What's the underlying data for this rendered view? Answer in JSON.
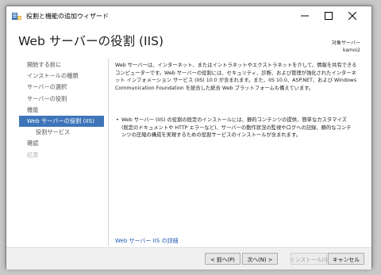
{
  "window": {
    "title": "役割と機能の追加ウィザード"
  },
  "header": {
    "page_title": "Web サーバーの役割 (IIS)",
    "target_label": "対象サーバー",
    "target_name": "kamoi2"
  },
  "sidebar": {
    "items": [
      {
        "label": "開始する前に",
        "state": "normal"
      },
      {
        "label": "インストールの種類",
        "state": "normal"
      },
      {
        "label": "サーバーの選択",
        "state": "normal"
      },
      {
        "label": "サーバーの役割",
        "state": "normal"
      },
      {
        "label": "機能",
        "state": "normal"
      },
      {
        "label": "Web サーバーの役割 (IIS)",
        "state": "active"
      },
      {
        "label": "役割サービス",
        "state": "sub"
      },
      {
        "label": "確認",
        "state": "normal"
      },
      {
        "label": "結果",
        "state": "disabled"
      }
    ]
  },
  "content": {
    "description": "Web サーバーは、インターネット、またはイントラネットやエクストラネットを介して、情報を共有できるコンピューターです。Web サーバーの役割には、セキュリティ、診断、および管理が強化されたインターネット インフォメーション サービス (IIS) 10.0 が含まれます。また、IIS 10.0、ASP.NET、および Windows Communication Foundation を統合した統合 Web プラットフォームも備えています。",
    "bullet_dot": "•",
    "bullet": "Web サーバー (IIS) の役割の既定のインストールには、静的コンテンツの提供、簡単なカスタマイズ (既定のドキュメントや HTTP エラーなど)、サーバーの動作状況の監視やログへの記録、静的なコンテンツの圧縮の構成を実現するための役割サービスのインストールが含まれます。",
    "link": "Web サーバー IIS の詳細"
  },
  "footer": {
    "prev": "< 前へ(P)",
    "next": "次へ(N) >",
    "install": "インストール(I)",
    "cancel": "キャンセル"
  },
  "colors": {
    "accent": "#3e75b9",
    "link": "#1c5ab0"
  }
}
